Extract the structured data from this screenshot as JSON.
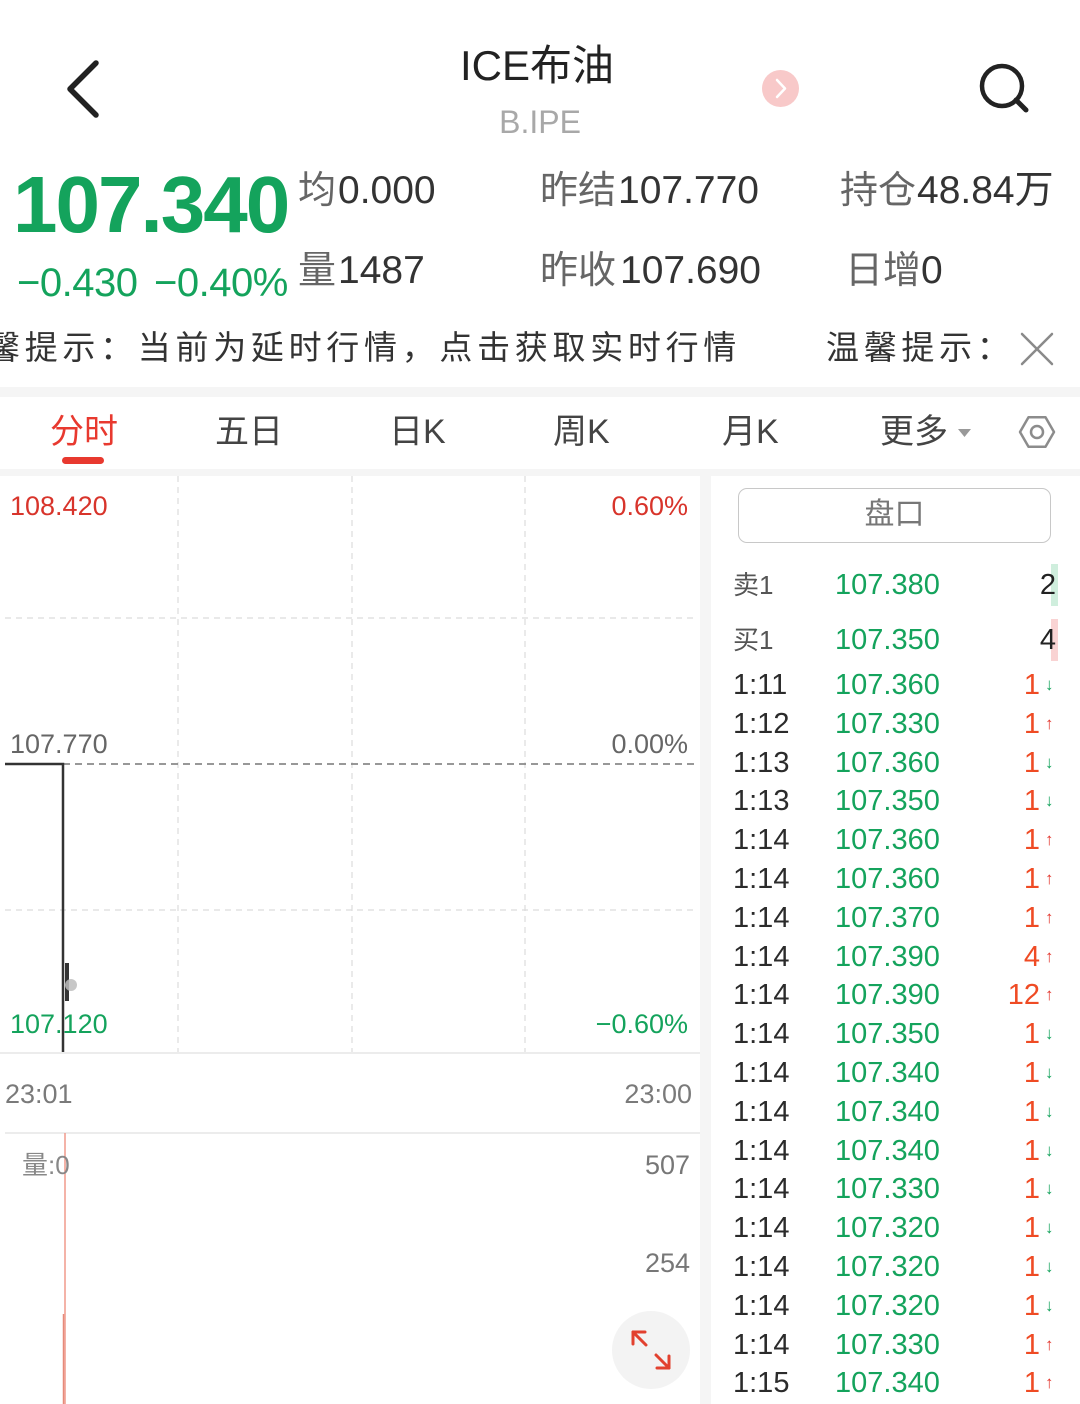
{
  "header": {
    "title": "ICE布油",
    "subtitle": "B.IPE",
    "back_icon": "chevron-left-icon",
    "next_icon": "chevron-right-icon",
    "search_icon": "search-icon"
  },
  "quote": {
    "price": "107.340",
    "change": "−0.430",
    "change_pct": "−0.40%",
    "stats": {
      "avg": {
        "label": "均",
        "value": "0.000"
      },
      "prev_settle": {
        "label": "昨结",
        "value": "107.770"
      },
      "open_interest": {
        "label": "持仓",
        "value": "48.84万"
      },
      "volume": {
        "label": "量",
        "value": "1487"
      },
      "prev_close": {
        "label": "昨收",
        "value": "107.690"
      },
      "oi_change": {
        "label": "日增",
        "value": "0"
      }
    }
  },
  "notice": {
    "text_1": "馨提示：当前为延时行情，点击获取实时行情",
    "text_2": "温馨提示：",
    "close_icon": "close-icon"
  },
  "tabs": [
    {
      "label": "分时",
      "active": true
    },
    {
      "label": "五日"
    },
    {
      "label": "日K"
    },
    {
      "label": "周K"
    },
    {
      "label": "月K"
    },
    {
      "label": "更多",
      "icon": "caret-down-icon"
    }
  ],
  "settings_icon": "gear-icon",
  "chart": {
    "price_high": "108.420",
    "pct_high": "0.60%",
    "price_mid": "107.770",
    "pct_mid": "0.00%",
    "price_low": "107.120",
    "pct_low": "−0.60%",
    "time_start": "23:01",
    "time_end": "23:00",
    "volume_label": "量:0",
    "volume_max": "507",
    "volume_mid": "254",
    "expand_icon": "expand-icon"
  },
  "orderbook": {
    "button_label": "盘口",
    "ask": {
      "label": "卖1",
      "price": "107.380",
      "volume": "2"
    },
    "bid": {
      "label": "买1",
      "price": "107.350",
      "volume": "4"
    },
    "trades": [
      {
        "time": "1:11",
        "price": "107.360",
        "volume": "1",
        "arrow": "↓"
      },
      {
        "time": "1:12",
        "price": "107.330",
        "volume": "1",
        "arrow": "↑"
      },
      {
        "time": "1:13",
        "price": "107.360",
        "volume": "1",
        "arrow": "↓"
      },
      {
        "time": "1:13",
        "price": "107.350",
        "volume": "1",
        "arrow": "↓"
      },
      {
        "time": "1:14",
        "price": "107.360",
        "volume": "1",
        "arrow": "↑"
      },
      {
        "time": "1:14",
        "price": "107.360",
        "volume": "1",
        "arrow": "↑"
      },
      {
        "time": "1:14",
        "price": "107.370",
        "volume": "1",
        "arrow": "↑"
      },
      {
        "time": "1:14",
        "price": "107.390",
        "volume": "4",
        "arrow": "↑"
      },
      {
        "time": "1:14",
        "price": "107.390",
        "volume": "12",
        "arrow": "↑"
      },
      {
        "time": "1:14",
        "price": "107.350",
        "volume": "1",
        "arrow": "↓"
      },
      {
        "time": "1:14",
        "price": "107.340",
        "volume": "1",
        "arrow": "↓"
      },
      {
        "time": "1:14",
        "price": "107.340",
        "volume": "1",
        "arrow": "↓"
      },
      {
        "time": "1:14",
        "price": "107.340",
        "volume": "1",
        "arrow": "↓"
      },
      {
        "time": "1:14",
        "price": "107.330",
        "volume": "1",
        "arrow": "↓"
      },
      {
        "time": "1:14",
        "price": "107.320",
        "volume": "1",
        "arrow": "↓"
      },
      {
        "time": "1:14",
        "price": "107.320",
        "volume": "1",
        "arrow": "↓"
      },
      {
        "time": "1:14",
        "price": "107.320",
        "volume": "1",
        "arrow": "↓"
      },
      {
        "time": "1:14",
        "price": "107.330",
        "volume": "1",
        "arrow": "↑"
      },
      {
        "time": "1:15",
        "price": "107.340",
        "volume": "1",
        "arrow": "↑"
      }
    ]
  },
  "colors": {
    "green": "#14a35c",
    "red": "#e2352c",
    "accent": "#e8392f",
    "volume": "#ef4b24"
  }
}
